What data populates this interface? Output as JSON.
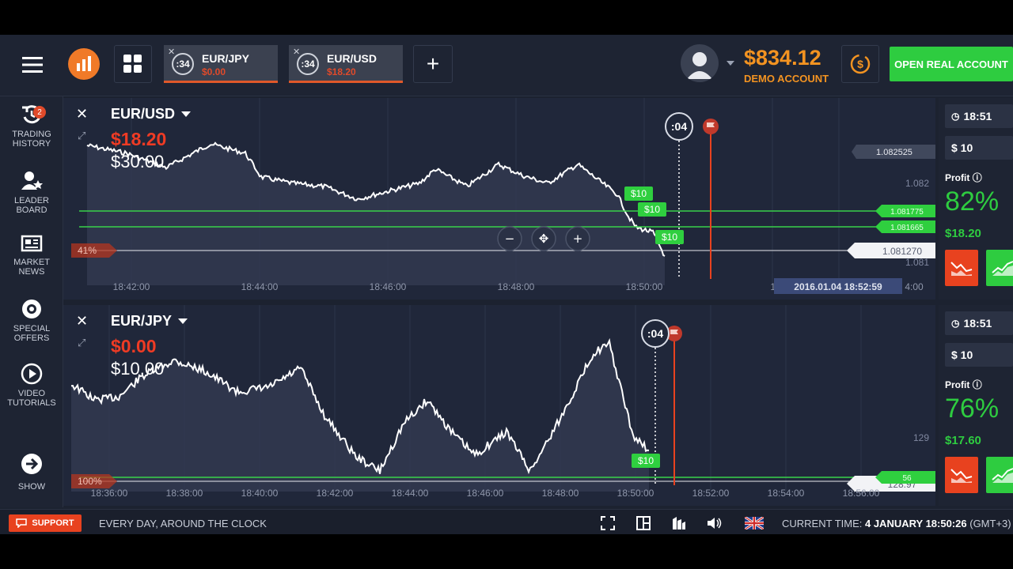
{
  "topbar": {
    "tabs": [
      {
        "timer": ":34",
        "pair": "EUR/JPY",
        "amount": "$0.00"
      },
      {
        "timer": ":34",
        "pair": "EUR/USD",
        "amount": "$18.20"
      }
    ],
    "add_label": "+",
    "balance": "$834.12",
    "account_type": "DEMO ACCOUNT",
    "open_real": "OPEN REAL ACCOUNT"
  },
  "sidebar": {
    "badge": "2",
    "items": [
      {
        "line1": "TRADING",
        "line2": "HISTORY",
        "icon": "history-icon"
      },
      {
        "line1": "LEADER",
        "line2": "BOARD",
        "icon": "leaderboard-icon"
      },
      {
        "line1": "MARKET",
        "line2": "NEWS",
        "icon": "news-icon"
      },
      {
        "line1": "SPECIAL",
        "line2": "OFFERS",
        "icon": "offers-icon"
      },
      {
        "line1": "VIDEO",
        "line2": "TUTORIALS",
        "icon": "play-icon"
      },
      {
        "line1": "SHOW",
        "line2": "",
        "icon": "arrow-right-icon"
      }
    ]
  },
  "charts": [
    {
      "pair": "EUR/USD",
      "profit": "$18.20",
      "invest": "$30.00",
      "countdown": ":04",
      "x_ticks": [
        "18:42:00",
        "18:44:00",
        "18:46:00",
        "18:48:00",
        "18:50:00",
        "18:5",
        "4:00"
      ],
      "y_labels": [
        "1.082525",
        "1.082",
        "1.081775",
        "1.081665",
        "1.081270",
        "1.081"
      ],
      "deal_markers": [
        "$10",
        "$10",
        "$10"
      ],
      "left_marker": "41%",
      "hover_time": "2016.01.04 18:52:59",
      "zoom_out": "−",
      "zoom_in": "+"
    },
    {
      "pair": "EUR/JPY",
      "profit": "$0.00",
      "invest": "$10.00",
      "countdown": ":04",
      "x_ticks": [
        "18:36:00",
        "18:38:00",
        "18:40:00",
        "18:42:00",
        "18:44:00",
        "18:46:00",
        "18:48:00",
        "18:50:00",
        "18:52:00",
        "18:54:00",
        "18:56:00"
      ],
      "y_labels": [
        "129",
        "128.97",
        "56"
      ],
      "deal_markers": [
        "$10"
      ],
      "left_marker": "100%"
    }
  ],
  "trade": [
    {
      "time": "18:51",
      "amount": "$ 10",
      "profit_label": "Profit",
      "profit_pct": "82%",
      "profit_amt": "$18.20"
    },
    {
      "time": "18:51",
      "amount": "$ 10",
      "profit_label": "Profit",
      "profit_pct": "76%",
      "profit_amt": "$17.60"
    }
  ],
  "footer": {
    "support": "SUPPORT",
    "slogan": "EVERY DAY, AROUND THE CLOCK",
    "time_label": "CURRENT TIME:",
    "time_value": "4 JANUARY 18:50:26",
    "tz": "(GMT+3)"
  },
  "colors": {
    "accent_orange": "#f39321",
    "green": "#2ecc40",
    "red": "#e8421f",
    "bg": "#1c2230"
  }
}
